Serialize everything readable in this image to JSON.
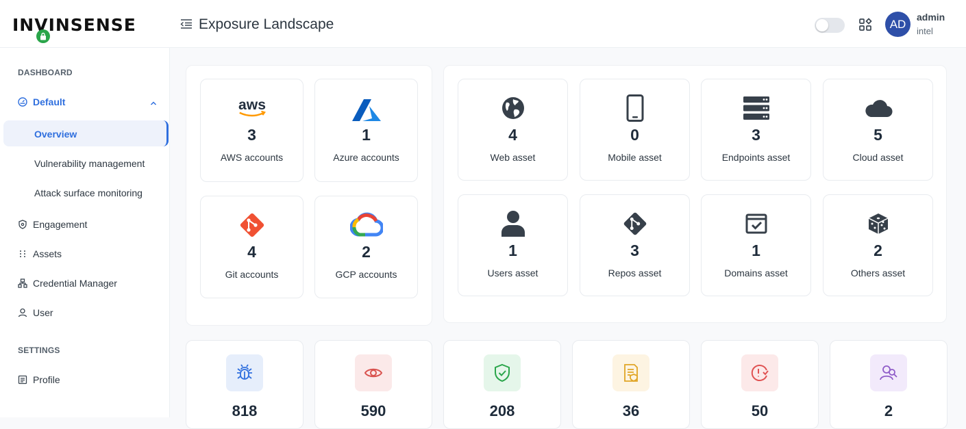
{
  "header": {
    "logo_text": "INVINSENSE",
    "title": "Exposure Landscape",
    "user_initials": "AD",
    "user_name": "admin",
    "user_org": "intel"
  },
  "sidebar": {
    "section_dashboard": "DASHBOARD",
    "default": "Default",
    "sub_items": [
      "Overview",
      "Vulnerability management",
      "Attack surface monitoring"
    ],
    "items": [
      "Engagement",
      "Assets",
      "Credential Manager",
      "User"
    ],
    "section_settings": "SETTINGS",
    "profile": "Profile"
  },
  "cloud_accounts": [
    {
      "value": "3",
      "label": "AWS accounts",
      "icon": "aws-logo"
    },
    {
      "value": "1",
      "label": "Azure accounts",
      "icon": "azure-logo"
    },
    {
      "value": "4",
      "label": "Git accounts",
      "icon": "git-logo"
    },
    {
      "value": "2",
      "label": "GCP accounts",
      "icon": "gcp-logo"
    }
  ],
  "assets": [
    {
      "value": "4",
      "label": "Web asset",
      "icon": "globe-icon"
    },
    {
      "value": "0",
      "label": "Mobile asset",
      "icon": "mobile-icon"
    },
    {
      "value": "3",
      "label": "Endpoints asset",
      "icon": "server-icon"
    },
    {
      "value": "5",
      "label": "Cloud asset",
      "icon": "cloud-icon"
    },
    {
      "value": "1",
      "label": "Users asset",
      "icon": "user-icon"
    },
    {
      "value": "3",
      "label": "Repos asset",
      "icon": "git-icon"
    },
    {
      "value": "1",
      "label": "Domains asset",
      "icon": "domain-check-icon"
    },
    {
      "value": "2",
      "label": "Others asset",
      "icon": "dice-icon"
    }
  ],
  "stats": [
    {
      "value": "818",
      "icon": "bug-icon",
      "color": "#2f6fde",
      "bg": "#e6eefb"
    },
    {
      "value": "590",
      "icon": "eye-icon",
      "color": "#d9534f",
      "bg": "#fbe9e9"
    },
    {
      "value": "208",
      "icon": "shield-check-icon",
      "color": "#2aa54a",
      "bg": "#e5f6ea"
    },
    {
      "value": "36",
      "icon": "report-icon",
      "color": "#e0a526",
      "bg": "#fdf4e2"
    },
    {
      "value": "50",
      "icon": "alert-clock-icon",
      "color": "#e05252",
      "bg": "#fce9e9"
    },
    {
      "value": "2",
      "icon": "users-icon",
      "color": "#8e5bc8",
      "bg": "#f2eafb"
    }
  ]
}
